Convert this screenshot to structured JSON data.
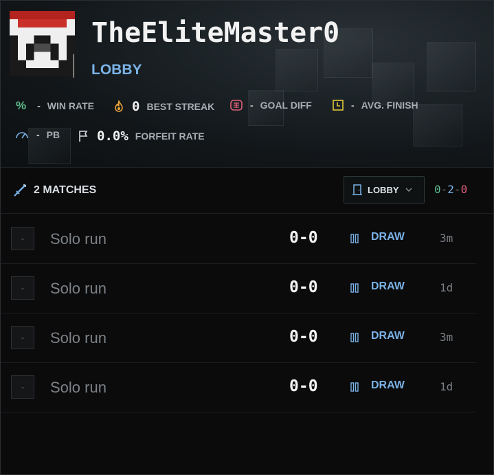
{
  "player": {
    "name": "TheEliteMaster0",
    "status": "LOBBY"
  },
  "stats": [
    {
      "icon": "percent-icon",
      "value": "-",
      "label": "WIN RATE",
      "color": "#5fbf8f"
    },
    {
      "icon": "flame-icon",
      "value": "0",
      "label": "BEST STREAK",
      "color": "#e8a23a"
    },
    {
      "icon": "goal-icon",
      "value": "-",
      "label": "GOAL DIFF",
      "color": "#e0607a"
    },
    {
      "icon": "clock-icon",
      "value": "-",
      "label": "AVG. FINISH",
      "color": "#e2c63a"
    },
    {
      "icon": "speedometer-icon",
      "value": "-",
      "label": "PB",
      "color": "#7bb3e8"
    },
    {
      "icon": "flag-icon",
      "value": "0.0%",
      "label": "FORFEIT RATE",
      "color": "#d9dde1"
    }
  ],
  "matches": {
    "title": "2 MATCHES",
    "filter_label": "LOBBY",
    "record": {
      "wins": "0",
      "draws": "2",
      "losses": "0",
      "sep": "-"
    },
    "rows": [
      {
        "rank": "-",
        "description": "Solo run",
        "score": "0-0",
        "result": "DRAW",
        "ago": "3m"
      },
      {
        "rank": "-",
        "description": "Solo run",
        "score": "0-0",
        "result": "DRAW",
        "ago": "1d"
      },
      {
        "rank": "-",
        "description": "Solo run",
        "score": "0-0",
        "result": "DRAW",
        "ago": "3m"
      },
      {
        "rank": "-",
        "description": "Solo run",
        "score": "0-0",
        "result": "DRAW",
        "ago": "1d"
      }
    ]
  },
  "colors": {
    "accent": "#7bb3e8",
    "win": "#5fbf8f",
    "loss": "#e0607a",
    "draw": "#7bb3e8"
  }
}
